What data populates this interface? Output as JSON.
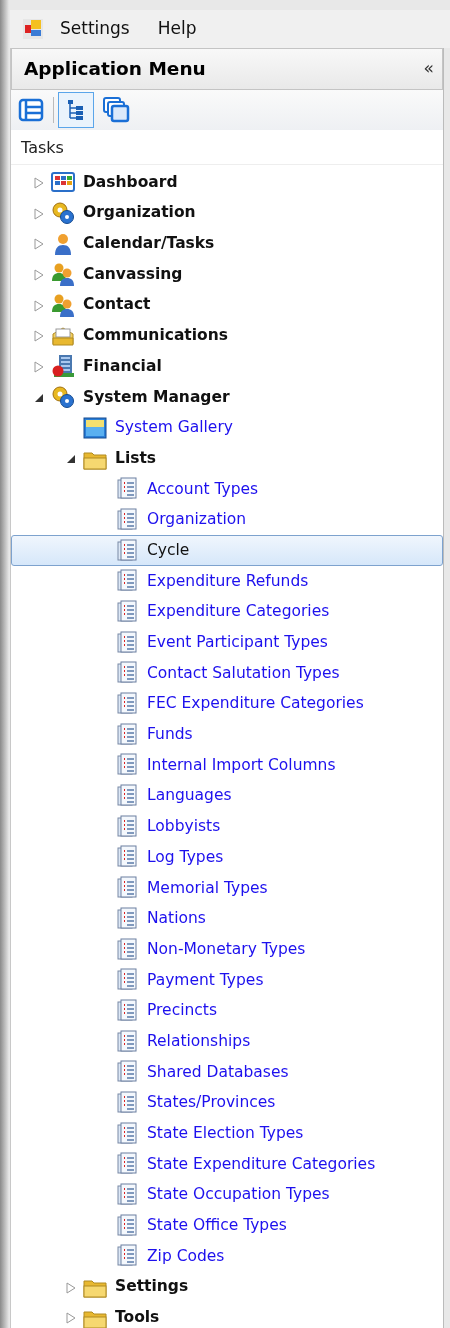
{
  "menu_bar": {
    "items": [
      "Settings",
      "Help"
    ]
  },
  "panel": {
    "title": "Application Menu",
    "collapse": "«"
  },
  "toolbar": [
    {
      "selected": false
    },
    {
      "selected": true
    },
    {
      "selected": false
    }
  ],
  "section": "Tasks",
  "tree": [
    {
      "label": "Dashboard",
      "kind": "dashboard",
      "expanded": false,
      "selected": false
    },
    {
      "label": "Organization",
      "kind": "gears",
      "expanded": false,
      "selected": false
    },
    {
      "label": "Calendar/Tasks",
      "kind": "person",
      "expanded": false,
      "selected": false
    },
    {
      "label": "Canvassing",
      "kind": "people",
      "expanded": false,
      "selected": false
    },
    {
      "label": "Contact",
      "kind": "people",
      "expanded": false,
      "selected": false
    },
    {
      "label": "Communications",
      "kind": "mail",
      "expanded": false,
      "selected": false
    },
    {
      "label": "Financial",
      "kind": "financial",
      "expanded": false,
      "selected": false
    },
    {
      "label": "System Manager",
      "kind": "gears",
      "expanded": true,
      "selected": false,
      "children": [
        {
          "label": "System Gallery",
          "kind": "gallery",
          "selected": false
        },
        {
          "label": "Lists",
          "kind": "folder",
          "expanded": true,
          "selected": false,
          "children": [
            {
              "label": "Account Types",
              "kind": "list",
              "selected": false
            },
            {
              "label": "Organization",
              "kind": "list",
              "selected": false
            },
            {
              "label": "Cycle",
              "kind": "list",
              "selected": true
            },
            {
              "label": "Expenditure Refunds",
              "kind": "list",
              "selected": false
            },
            {
              "label": "Expenditure Categories",
              "kind": "list",
              "selected": false
            },
            {
              "label": "Event Participant Types",
              "kind": "list",
              "selected": false
            },
            {
              "label": "Contact Salutation Types",
              "kind": "list",
              "selected": false
            },
            {
              "label": "FEC Expenditure Categories",
              "kind": "list",
              "selected": false
            },
            {
              "label": "Funds",
              "kind": "list",
              "selected": false
            },
            {
              "label": "Internal Import Columns",
              "kind": "list",
              "selected": false
            },
            {
              "label": "Languages",
              "kind": "list",
              "selected": false
            },
            {
              "label": "Lobbyists",
              "kind": "list",
              "selected": false
            },
            {
              "label": "Log Types",
              "kind": "list",
              "selected": false
            },
            {
              "label": "Memorial Types",
              "kind": "list",
              "selected": false
            },
            {
              "label": "Nations",
              "kind": "list",
              "selected": false
            },
            {
              "label": "Non-Monetary Types",
              "kind": "list",
              "selected": false
            },
            {
              "label": "Payment Types",
              "kind": "list",
              "selected": false
            },
            {
              "label": "Precincts",
              "kind": "list",
              "selected": false
            },
            {
              "label": "Relationships",
              "kind": "list",
              "selected": false
            },
            {
              "label": "Shared Databases",
              "kind": "list",
              "selected": false
            },
            {
              "label": "States/Provinces",
              "kind": "list",
              "selected": false
            },
            {
              "label": "State Election Types",
              "kind": "list",
              "selected": false
            },
            {
              "label": "State Expenditure Categories",
              "kind": "list",
              "selected": false
            },
            {
              "label": "State Occupation Types",
              "kind": "list",
              "selected": false
            },
            {
              "label": "State Office Types",
              "kind": "list",
              "selected": false
            },
            {
              "label": "Zip Codes",
              "kind": "list",
              "selected": false
            }
          ]
        },
        {
          "label": "Settings",
          "kind": "folder",
          "expanded": false,
          "selected": false
        },
        {
          "label": "Tools",
          "kind": "folder",
          "expanded": false,
          "selected": false
        }
      ]
    }
  ]
}
